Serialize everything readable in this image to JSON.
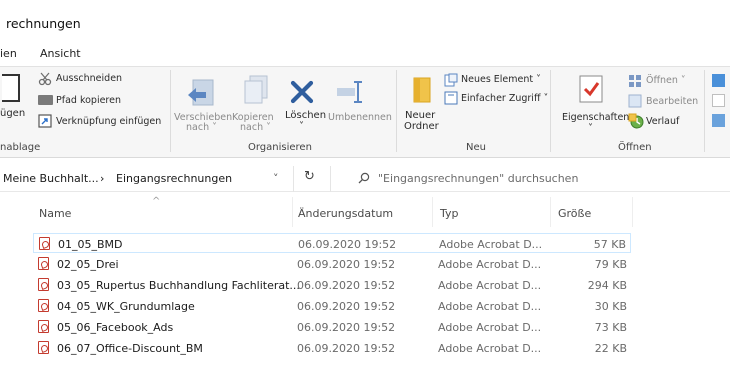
{
  "window": {
    "title": "rechnungen"
  },
  "tabs": [
    {
      "label": "ien"
    },
    {
      "label": "Ansicht"
    }
  ],
  "ribbon": {
    "clipboard": {
      "paste_label": "ügen",
      "cut_label": "Ausschneiden",
      "copy_path_label": "Pfad kopieren",
      "paste_shortcut_label": "Verknüpfung einfügen",
      "group_label": "nablage"
    },
    "organize": {
      "move_label": "Verschieben",
      "move_sub": "nach ˅",
      "copy_label": "Kopieren",
      "copy_sub": "nach ˅",
      "delete_label": "Löschen",
      "delete_sub": "˅",
      "rename_label": "Umbenennen",
      "group_label": "Organisieren"
    },
    "new": {
      "folder_label": "Neuer",
      "folder_sub": "Ordner",
      "new_item_label": "Neues Element ˅",
      "easy_access_label": "Einfacher Zugriff ˅",
      "group_label": "Neu"
    },
    "open": {
      "properties_label": "Eigenschaften",
      "properties_sub": "˅",
      "open_label": "Öffnen ˅",
      "edit_label": "Bearbeiten",
      "history_label": "Verlauf",
      "group_label": "Öffnen"
    }
  },
  "address": {
    "crumb_parent": "Meine Buchhalt...",
    "crumb_sep": "›",
    "crumb_current": "Eingangsrechnungen",
    "dropdown": "˅",
    "refresh": "↻",
    "search_placeholder": "\"Eingangsrechnungen\" durchsuchen"
  },
  "columns": {
    "name": "Name",
    "date": "Änderungsdatum",
    "type": "Typ",
    "size": "Größe"
  },
  "files": [
    {
      "name": "01_05_BMD",
      "date": "06.09.2020 19:52",
      "type": "Adobe Acrobat D...",
      "size": "57 KB"
    },
    {
      "name": "02_05_Drei",
      "date": "06.09.2020 19:52",
      "type": "Adobe Acrobat D...",
      "size": "79 KB"
    },
    {
      "name": "03_05_Rupertus Buchhandlung Fachliterat...",
      "date": "06.09.2020 19:52",
      "type": "Adobe Acrobat D...",
      "size": "294 KB"
    },
    {
      "name": "04_05_WK_Grundumlage",
      "date": "06.09.2020 19:52",
      "type": "Adobe Acrobat D...",
      "size": "30 KB"
    },
    {
      "name": "05_06_Facebook_Ads",
      "date": "06.09.2020 19:52",
      "type": "Adobe Acrobat D...",
      "size": "73 KB"
    },
    {
      "name": "06_07_Office-Discount_BM",
      "date": "06.09.2020 19:52",
      "type": "Adobe Acrobat D...",
      "size": "22 KB"
    }
  ]
}
